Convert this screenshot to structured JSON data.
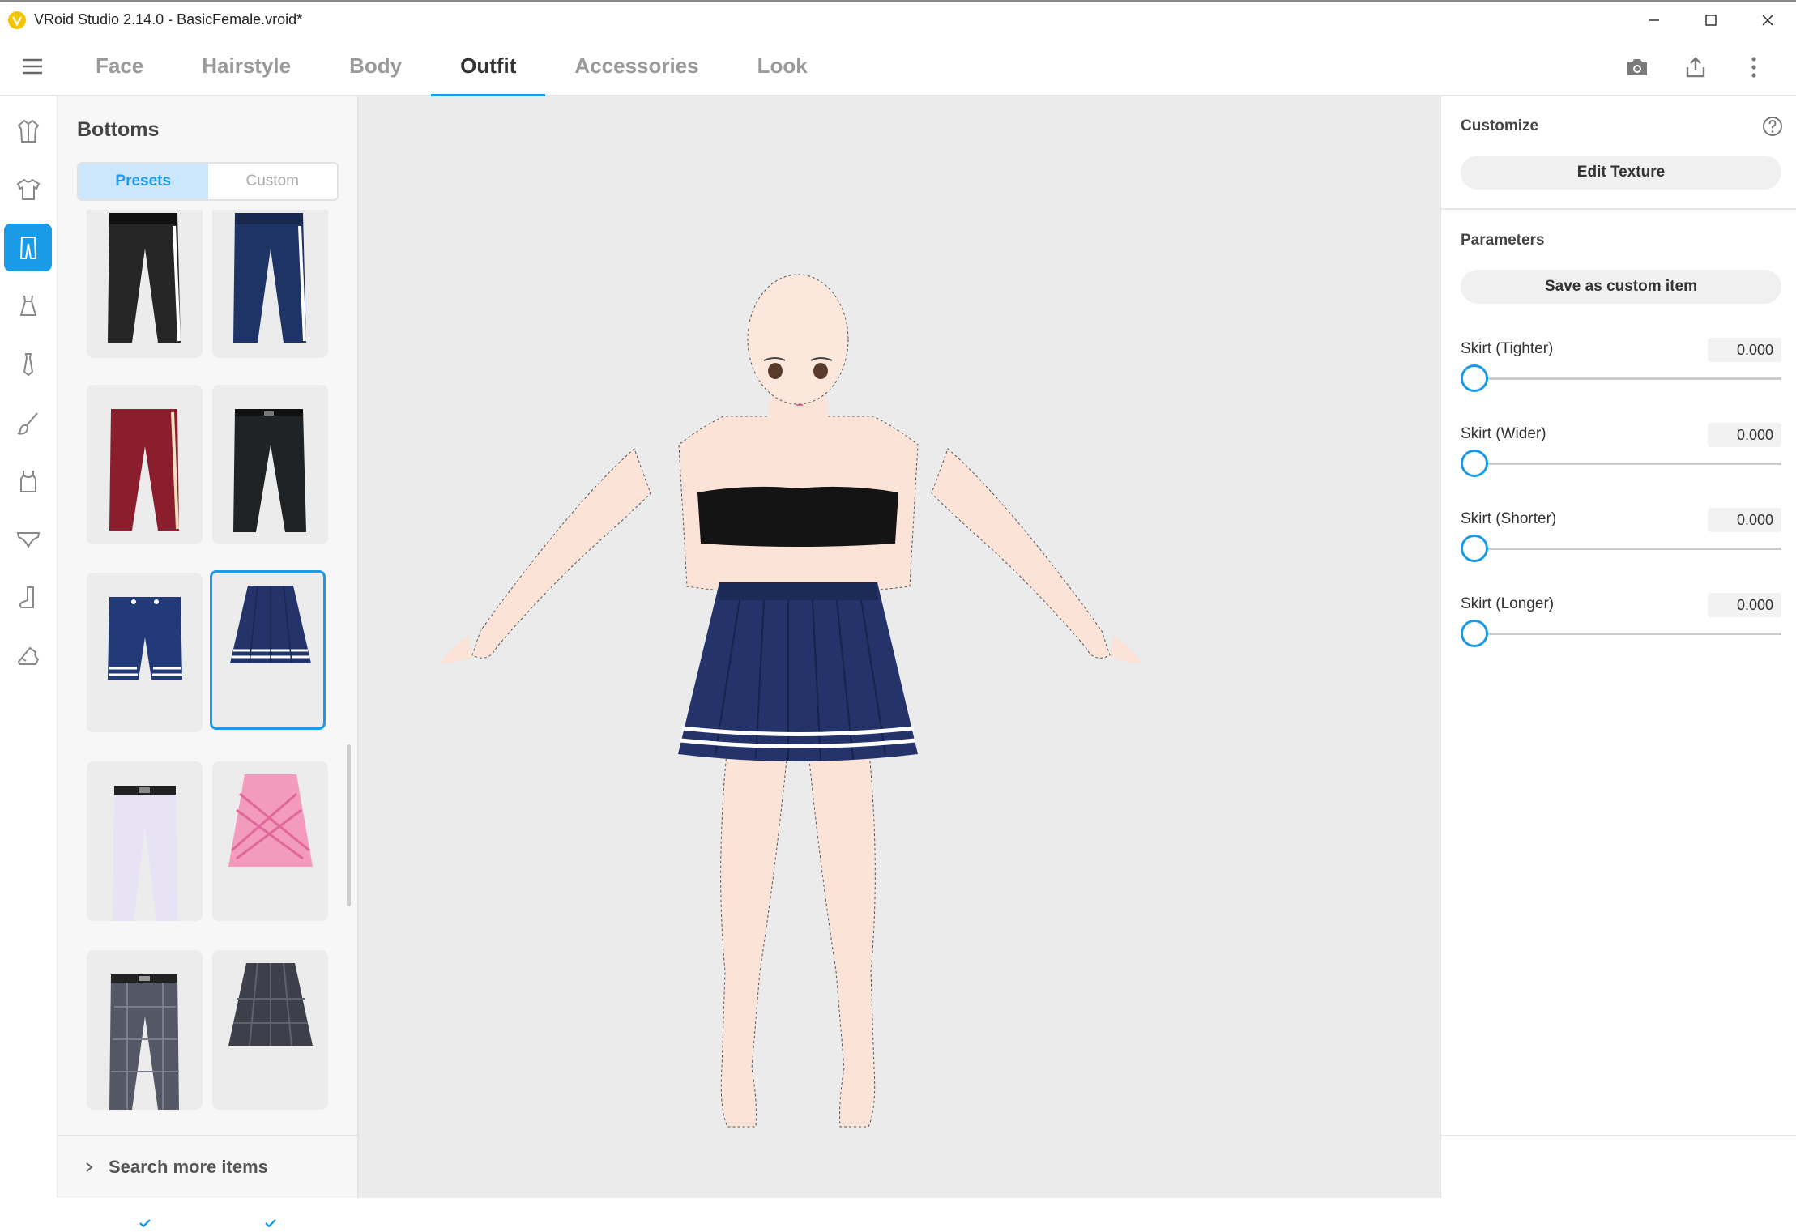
{
  "window": {
    "title": "VRoid Studio 2.14.0 - BasicFemale.vroid*",
    "controls": [
      "minimize-icon",
      "maximize-icon",
      "close-icon"
    ]
  },
  "nav": {
    "tabs": [
      {
        "label": "Face",
        "active": false
      },
      {
        "label": "Hairstyle",
        "active": false
      },
      {
        "label": "Body",
        "active": false
      },
      {
        "label": "Outfit",
        "active": true
      },
      {
        "label": "Accessories",
        "active": false
      },
      {
        "label": "Look",
        "active": false
      }
    ],
    "actions": [
      "camera-icon",
      "export-icon",
      "more-vertical-icon"
    ],
    "accent": "#1a9be8"
  },
  "rail": {
    "items": [
      {
        "icon": "jacket-icon",
        "active": false
      },
      {
        "icon": "shirt-icon",
        "active": false
      },
      {
        "icon": "pants-icon",
        "active": true
      },
      {
        "icon": "dress-icon",
        "active": false
      },
      {
        "icon": "tie-icon",
        "active": false
      },
      {
        "icon": "brush-icon",
        "active": false
      },
      {
        "icon": "tank-top-icon",
        "active": false
      },
      {
        "icon": "underwear-icon",
        "active": false
      },
      {
        "icon": "sock-icon",
        "active": false
      },
      {
        "icon": "shoe-icon",
        "active": false
      }
    ]
  },
  "panel": {
    "title": "Bottoms",
    "segments": [
      {
        "label": "Presets",
        "active": true
      },
      {
        "label": "Custom",
        "active": false
      }
    ],
    "items": [
      {
        "name": "black-pants-white-stripe",
        "checked": true,
        "selected": false
      },
      {
        "name": "navy-pants-white-stripe",
        "checked": true,
        "selected": false
      },
      {
        "name": "red-pants-white-stripe",
        "checked": true,
        "selected": false
      },
      {
        "name": "black-slacks",
        "checked": true,
        "selected": false
      },
      {
        "name": "navy-shorts",
        "checked": true,
        "selected": false
      },
      {
        "name": "navy-pleated-skirt",
        "checked": true,
        "selected": true
      },
      {
        "name": "white-pants",
        "checked": true,
        "selected": false
      },
      {
        "name": "pink-plaid-skirt",
        "checked": true,
        "selected": false
      },
      {
        "name": "gray-plaid-pants",
        "checked": true,
        "selected": false
      },
      {
        "name": "gray-plaid-skirt",
        "checked": true,
        "selected": false
      }
    ],
    "search_more": "Search more items"
  },
  "right": {
    "customize_title": "Customize",
    "edit_texture": "Edit Texture",
    "parameters_title": "Parameters",
    "save_custom": "Save as custom item",
    "params": [
      {
        "label": "Skirt (Tighter)",
        "value": "0.000",
        "level": 0
      },
      {
        "label": "Skirt (Wider)",
        "value": "0.000",
        "level": 0
      },
      {
        "label": "Skirt (Shorter)",
        "value": "0.000",
        "level": 0
      },
      {
        "label": "Skirt (Longer)",
        "value": "0.000",
        "level": 0
      }
    ]
  }
}
